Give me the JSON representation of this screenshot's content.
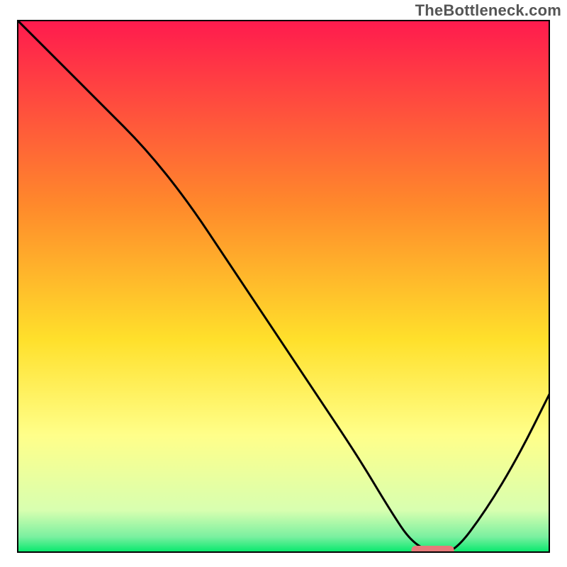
{
  "watermark": "TheBottleneck.com",
  "colors": {
    "gradient_top": "#ff1a4e",
    "gradient_mid1": "#ff8a2b",
    "gradient_mid2": "#ffe02b",
    "gradient_low": "#ffff8a",
    "gradient_bottom": "#00e86a",
    "curve": "#000000",
    "marker_fill": "#e67a7a",
    "frame": "#000000"
  },
  "chart_data": {
    "type": "line",
    "title": "",
    "xlabel": "",
    "ylabel": "",
    "xlim": [
      0,
      100
    ],
    "ylim": [
      0,
      100
    ],
    "grid": false,
    "legend": false,
    "series": [
      {
        "name": "bottleneck-curve",
        "x": [
          0,
          8,
          16,
          24,
          32,
          40,
          48,
          56,
          64,
          70,
          74,
          78,
          82,
          88,
          94,
          100
        ],
        "y": [
          100,
          92,
          84,
          76,
          66,
          54,
          42,
          30,
          18,
          8,
          2,
          0,
          0,
          8,
          18,
          30
        ]
      }
    ],
    "marker": {
      "name": "optimal-range",
      "x_start": 74,
      "x_end": 82,
      "y": 0
    },
    "gradient_stops_pct": [
      0,
      35,
      60,
      78,
      92,
      97,
      100
    ]
  }
}
